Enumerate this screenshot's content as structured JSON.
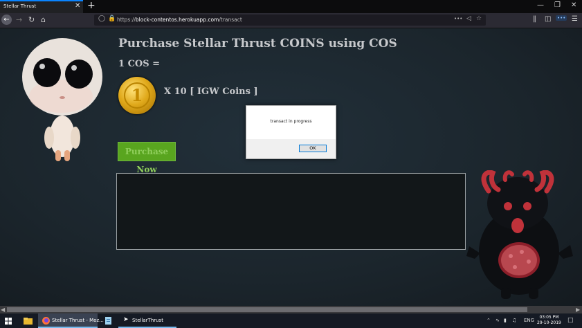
{
  "browser": {
    "tab_title": "Stellar Thrust",
    "tab_close": "✕",
    "new_tab": "+",
    "url_scheme": "https://",
    "url_host": "block-contentos.herokuapp.com",
    "url_path": "/transact",
    "menu_dots": "•••"
  },
  "page": {
    "heading": "Purchase Stellar Thrust COINS using COS",
    "rate_label": "1 COS =",
    "coin_numeral": "1",
    "coin_amount": "X 10 [ IGW Coins ]",
    "purchase_button": "Purchase Now"
  },
  "dialog": {
    "message": "transact in progress",
    "ok_label": "OK"
  },
  "taskbar": {
    "firefox_label": "Stellar Thrust - Moz...",
    "app_label": "StellarThrust",
    "language": "ENG",
    "time": "03:05 PM",
    "date": "29-10-2019"
  }
}
